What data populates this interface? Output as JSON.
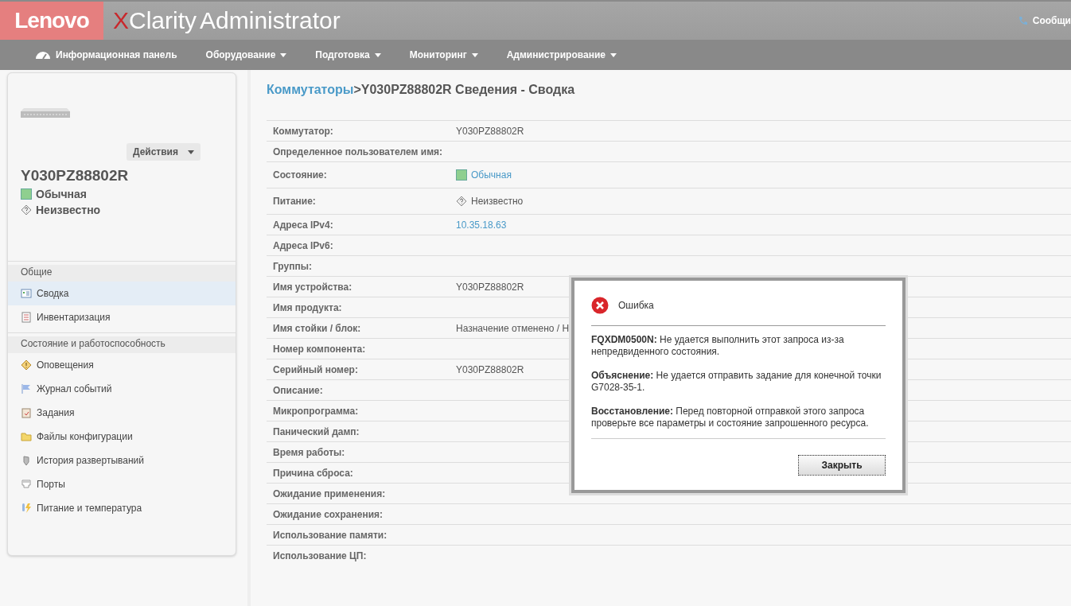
{
  "header": {
    "brand": "Lenovo",
    "product_x": "X",
    "product": "Clarity",
    "product_rest": "Administrator",
    "messages": "Сообщи"
  },
  "nav": [
    {
      "label": "Информационная панель",
      "has_menu": false
    },
    {
      "label": "Оборудование",
      "has_menu": true
    },
    {
      "label": "Подготовка",
      "has_menu": true
    },
    {
      "label": "Мониторинг",
      "has_menu": true
    },
    {
      "label": "Администрирование",
      "has_menu": true
    }
  ],
  "sidebar": {
    "actions": "Действия",
    "device_name": "Y030PZ88802R",
    "statuses": [
      {
        "kind": "normal",
        "label": "Обычная"
      },
      {
        "kind": "unknown",
        "label": "Неизвестно"
      }
    ],
    "sections": [
      {
        "title": "Общие",
        "items": [
          {
            "label": "Сводка",
            "selected": true
          },
          {
            "label": "Инвентаризация",
            "selected": false
          }
        ]
      },
      {
        "title": "Состояние и работоспособность",
        "items": [
          {
            "label": "Оповещения",
            "selected": false
          },
          {
            "label": "Журнал событий",
            "selected": false
          },
          {
            "label": "Задания",
            "selected": false
          },
          {
            "label": "Файлы конфигурации",
            "selected": false
          },
          {
            "label": "История развертываний",
            "selected": false
          },
          {
            "label": "Порты",
            "selected": false
          },
          {
            "label": "Питание и температура",
            "selected": false
          }
        ]
      }
    ]
  },
  "breadcrumb": {
    "link": "Коммутаторы",
    "title": ">Y030PZ88802R Сведения - Сводка"
  },
  "rows": [
    {
      "label": "Коммутатор:",
      "value": "Y030PZ88802R",
      "kind": "text"
    },
    {
      "label": "Определенное пользователем имя:"
    },
    {
      "label": "Состояние:",
      "value": "Обычная",
      "kind": "normal"
    },
    {
      "label": "Питание:",
      "value": "Неизвестно",
      "kind": "unknown"
    },
    {
      "label": "Адреса IPv4:",
      "value": "10.35.18.63",
      "kind": "link"
    },
    {
      "label": "Адреса IPv6:"
    },
    {
      "label": "Группы:"
    },
    {
      "label": "Имя устройства:",
      "value": "Y030PZ88802R",
      "kind": "text"
    },
    {
      "label": "Имя продукта:"
    },
    {
      "label": "Имя стойки / блок:",
      "value": "Назначение отменено / Н",
      "kind": "text"
    },
    {
      "label": "Номер компонента:"
    },
    {
      "label": "Серийный номер:",
      "value": "Y030PZ88802R",
      "kind": "text"
    },
    {
      "label": "Описание:"
    },
    {
      "label": "Микропрограмма:"
    },
    {
      "label": "Панический дамп:"
    },
    {
      "label": "Время работы:"
    },
    {
      "label": "Причина сброса:"
    },
    {
      "label": "Ожидание применения:"
    },
    {
      "label": "Ожидание сохранения:"
    },
    {
      "label": "Использование памяти:"
    },
    {
      "label": "Использование ЦП:"
    }
  ],
  "dialog": {
    "title": "Ошибка",
    "paragraphs": [
      "**FQXDM0500N:** Не удается выполнить этот запроса из-за непредвиденного состояния.",
      "**Объяснение:** Не удается отправить задание для конечной точки G7028-35-1.",
      "**Восстановление:** Перед повторной отправкой этого запроса проверьте все параметры и состояние запрошенного ресурса."
    ],
    "button": "Закрыть"
  }
}
